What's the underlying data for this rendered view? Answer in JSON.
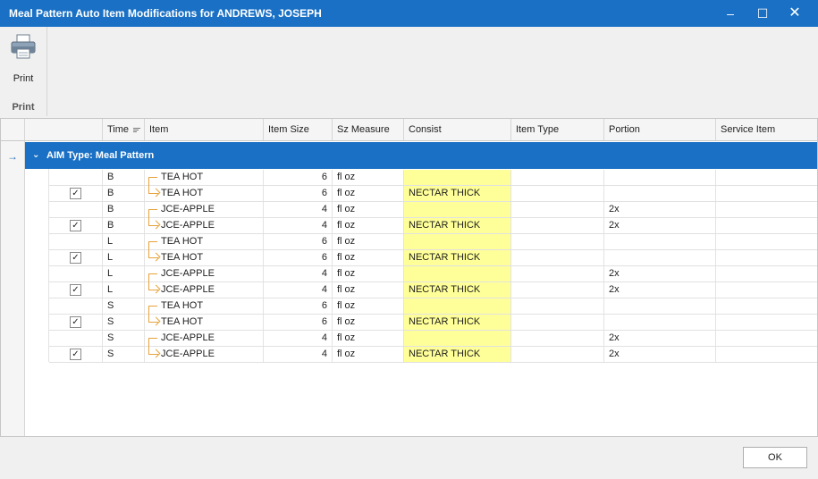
{
  "window": {
    "title": "Meal Pattern Auto Item Modifications for ANDREWS, JOSEPH",
    "minimize": "–",
    "maximize": "☐",
    "close": "✕"
  },
  "ribbon": {
    "print_label": "Print",
    "group_label": "Print"
  },
  "grid": {
    "columns": [
      "Time",
      "Item",
      "Item Size",
      "Sz Measure",
      "Consist",
      "Item Type",
      "Portion",
      "Service Item"
    ],
    "group_label": "AIM Type: Meal Pattern",
    "rows": [
      {
        "checked": false,
        "time": "B",
        "item": "TEA HOT",
        "link": "start",
        "size": "6",
        "measure": "fl oz",
        "consist": "",
        "item_type": "",
        "portion": "",
        "service_item": ""
      },
      {
        "checked": true,
        "time": "B",
        "item": "TEA HOT",
        "link": "end",
        "size": "6",
        "measure": "fl oz",
        "consist": "NECTAR THICK",
        "item_type": "",
        "portion": "",
        "service_item": ""
      },
      {
        "checked": false,
        "time": "B",
        "item": "JCE-APPLE",
        "link": "start",
        "size": "4",
        "measure": "fl oz",
        "consist": "",
        "item_type": "",
        "portion": "2x",
        "service_item": ""
      },
      {
        "checked": true,
        "time": "B",
        "item": "JCE-APPLE",
        "link": "end",
        "size": "4",
        "measure": "fl oz",
        "consist": "NECTAR THICK",
        "item_type": "",
        "portion": "2x",
        "service_item": ""
      },
      {
        "checked": false,
        "time": "L",
        "item": "TEA HOT",
        "link": "start",
        "size": "6",
        "measure": "fl oz",
        "consist": "",
        "item_type": "",
        "portion": "",
        "service_item": ""
      },
      {
        "checked": true,
        "time": "L",
        "item": "TEA HOT",
        "link": "end",
        "size": "6",
        "measure": "fl oz",
        "consist": "NECTAR THICK",
        "item_type": "",
        "portion": "",
        "service_item": ""
      },
      {
        "checked": false,
        "time": "L",
        "item": "JCE-APPLE",
        "link": "start",
        "size": "4",
        "measure": "fl oz",
        "consist": "",
        "item_type": "",
        "portion": "2x",
        "service_item": ""
      },
      {
        "checked": true,
        "time": "L",
        "item": "JCE-APPLE",
        "link": "end",
        "size": "4",
        "measure": "fl oz",
        "consist": "NECTAR THICK",
        "item_type": "",
        "portion": "2x",
        "service_item": ""
      },
      {
        "checked": false,
        "time": "S",
        "item": "TEA HOT",
        "link": "start",
        "size": "6",
        "measure": "fl oz",
        "consist": "",
        "item_type": "",
        "portion": "",
        "service_item": ""
      },
      {
        "checked": true,
        "time": "S",
        "item": "TEA HOT",
        "link": "end",
        "size": "6",
        "measure": "fl oz",
        "consist": "NECTAR THICK",
        "item_type": "",
        "portion": "",
        "service_item": ""
      },
      {
        "checked": false,
        "time": "S",
        "item": "JCE-APPLE",
        "link": "start",
        "size": "4",
        "measure": "fl oz",
        "consist": "",
        "item_type": "",
        "portion": "2x",
        "service_item": ""
      },
      {
        "checked": true,
        "time": "S",
        "item": "JCE-APPLE",
        "link": "end",
        "size": "4",
        "measure": "fl oz",
        "consist": "NECTAR THICK",
        "item_type": "",
        "portion": "2x",
        "service_item": ""
      }
    ]
  },
  "footer": {
    "ok_label": "OK"
  },
  "colors": {
    "title_bar": "#1a70c4",
    "group_row": "#1a70c4",
    "consist_highlight": "#ffff99",
    "link_line": "#e6a33c"
  },
  "icons": {
    "print": "printer-icon",
    "row_indicator": "arrow-right-icon",
    "group_toggle": "chevron-down-icon",
    "sort": "sort-icon"
  }
}
